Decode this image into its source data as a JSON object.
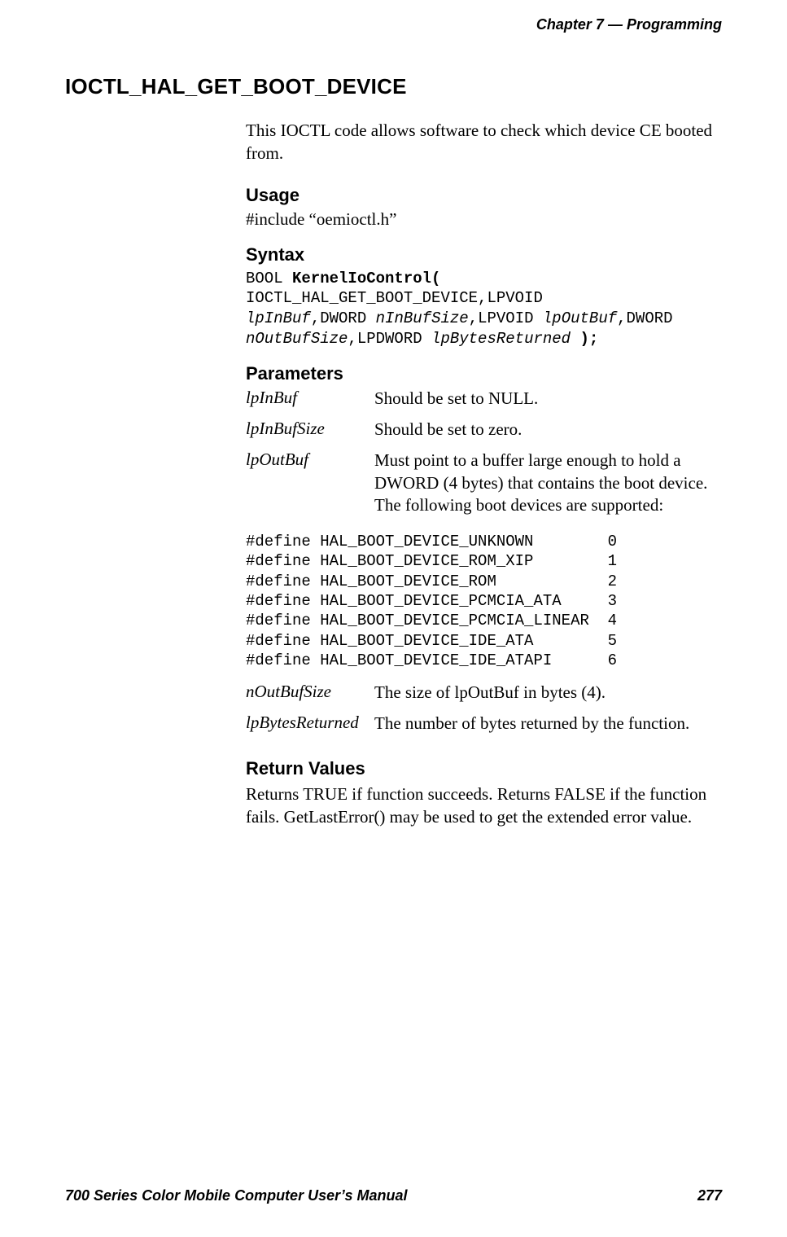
{
  "header": {
    "chapter_label": "Chapter",
    "chapter_number": "7",
    "separator": "—",
    "chapter_title": "Programming"
  },
  "section_title": "IOCTL_HAL_GET_BOOT_DEVICE",
  "intro": "This IOCTL code allows software to check which device CE booted from.",
  "usage": {
    "heading": "Usage",
    "text": "#include “oemioctl.h”"
  },
  "syntax": {
    "heading": "Syntax",
    "prefix": "BOOL ",
    "func_open": "KernelIoControl(",
    "seg1": " IOCTL_HAL_GET_BOOT_DEVICE,LPVOID",
    "param1": "lpInBuf",
    "seg2": ",DWORD ",
    "param2": "nInBufSize",
    "seg3": ",LPVOID ",
    "param3": "lpOutBuf",
    "seg4": ",DWORD",
    "param4": "nOutBufSize",
    "seg5": ",LPDWORD ",
    "param5": "lpBytesReturned",
    "close": " );"
  },
  "parameters": {
    "heading": "Parameters",
    "rows": [
      {
        "name": "lpInBuf",
        "desc": "Should be set to NULL."
      },
      {
        "name": "lpInBufSize",
        "desc": "Should be set to zero."
      },
      {
        "name": "lpOutBuf",
        "desc": "Must point to a buffer large enough to hold a DWORD (4 bytes) that contains the boot device. The following boot devices are supported:"
      }
    ],
    "defines": "#define HAL_BOOT_DEVICE_UNKNOWN        0\n#define HAL_BOOT_DEVICE_ROM_XIP        1\n#define HAL_BOOT_DEVICE_ROM            2\n#define HAL_BOOT_DEVICE_PCMCIA_ATA     3\n#define HAL_BOOT_DEVICE_PCMCIA_LINEAR  4\n#define HAL_BOOT_DEVICE_IDE_ATA        5\n#define HAL_BOOT_DEVICE_IDE_ATAPI      6",
    "rows2": [
      {
        "name": "nOutBufSize",
        "desc": "The size of lpOutBuf in bytes (4)."
      },
      {
        "name": "lpBytesReturned",
        "desc": "The number of bytes returned by the function."
      }
    ]
  },
  "return_values": {
    "heading": "Return Values",
    "text": "Returns TRUE if function succeeds. Returns FALSE if the function fails. GetLastError() may be used to get the extended error value."
  },
  "footer": {
    "manual_title": "700 Series Color Mobile Computer User’s Manual",
    "page_number": "277"
  }
}
